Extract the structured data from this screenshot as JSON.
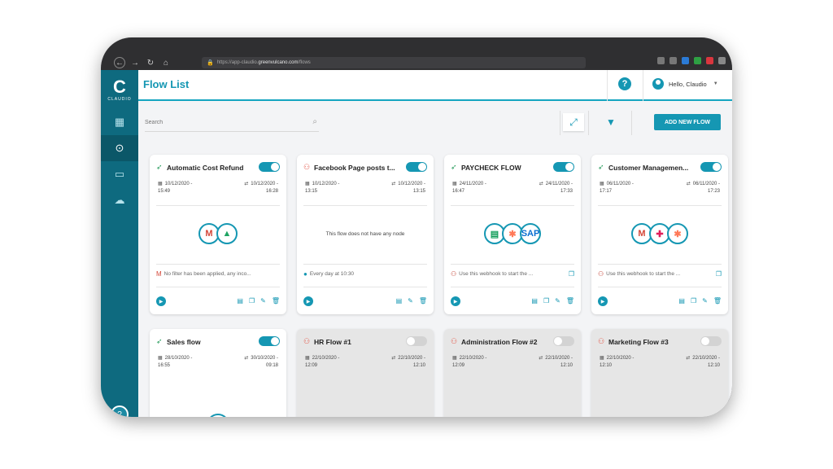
{
  "browser": {
    "url_prefix": "https://app-claudio.",
    "url_host": "greenvulcano.com",
    "url_path": "/flows"
  },
  "sidebar": {
    "logo_mark": "C",
    "logo_name": "CLAUDIO",
    "items": [
      {
        "icon": "dashboard-icon",
        "glyph": "▦"
      },
      {
        "icon": "flow-icon",
        "glyph": "⊙"
      },
      {
        "icon": "terminal-icon",
        "glyph": "▭"
      },
      {
        "icon": "cloud-icon",
        "glyph": "☁"
      }
    ],
    "bottom_glyph": "?"
  },
  "header": {
    "title": "Flow List",
    "help_glyph": "?",
    "user_greeting": "Hello, Claudio"
  },
  "toolbar": {
    "search_placeholder": "Search",
    "add_label": "ADD NEW FLOW"
  },
  "flows": [
    {
      "title": "Automatic Cost Refund",
      "icon": "rocket",
      "active": true,
      "created": "10/12/2020 -",
      "created_time": "15:49",
      "updated": "10/12/2020 -",
      "updated_time": "16:28",
      "nodes": [
        {
          "glyph": "M",
          "color": "#d44638"
        },
        {
          "glyph": "▲",
          "color": "#1fa463"
        }
      ],
      "empty_text": "",
      "trigger": "No filter has been applied, any inco...",
      "trigger_icon": "gmail",
      "has_copy": false
    },
    {
      "title": "Facebook Page posts t...",
      "icon": "webhook",
      "active": true,
      "created": "10/12/2020 -",
      "created_time": "13:15",
      "updated": "10/12/2020 -",
      "updated_time": "13:15",
      "nodes": [],
      "empty_text": "This flow does not have any node",
      "trigger": "Every day at 10:30",
      "trigger_icon": "clock",
      "has_copy": false
    },
    {
      "title": "PAYCHECK FLOW",
      "icon": "rocket",
      "active": true,
      "created": "24/11/2020 -",
      "created_time": "16:47",
      "updated": "24/11/2020 -",
      "updated_time": "17:33",
      "nodes": [
        {
          "glyph": "▤",
          "color": "#0f9d58"
        },
        {
          "glyph": "✱",
          "color": "#ff7a59"
        },
        {
          "glyph": "SAP",
          "color": "#0a6ed1"
        }
      ],
      "empty_text": "",
      "trigger": "Use this webhook to start the ...",
      "trigger_icon": "webhook",
      "has_copy": true
    },
    {
      "title": "Customer Managemen...",
      "icon": "rocket",
      "active": true,
      "created": "06/11/2020 -",
      "created_time": "17:17",
      "updated": "06/11/2020 -",
      "updated_time": "17:23",
      "nodes": [
        {
          "glyph": "M",
          "color": "#d44638"
        },
        {
          "glyph": "✚",
          "color": "#e01e5a"
        },
        {
          "glyph": "✱",
          "color": "#ff7a59"
        }
      ],
      "empty_text": "",
      "trigger": "Use this webhook to start the ...",
      "trigger_icon": "webhook",
      "has_copy": true
    },
    {
      "title": "Sales flow",
      "icon": "rocket",
      "active": true,
      "created": "28/10/2020 -",
      "created_time": "16:55",
      "updated": "30/10/2020 -",
      "updated_time": "09:18",
      "nodes": [],
      "empty_text": "",
      "trigger": "",
      "partial": true
    },
    {
      "title": "HR Flow #1",
      "icon": "webhook",
      "active": false,
      "created": "22/10/2020 -",
      "created_time": "12:09",
      "updated": "22/10/2020 -",
      "updated_time": "12:10",
      "nodes": [],
      "empty_text": "",
      "trigger": "",
      "partial": true
    },
    {
      "title": "Administration Flow #2",
      "icon": "webhook",
      "active": false,
      "created": "22/10/2020 -",
      "created_time": "12:09",
      "updated": "22/10/2020 -",
      "updated_time": "12:10",
      "nodes": [],
      "empty_text": "",
      "trigger": "",
      "partial": true
    },
    {
      "title": "Marketing Flow #3",
      "icon": "webhook",
      "active": false,
      "created": "22/10/2020 -",
      "created_time": "12:10",
      "updated": "22/10/2020 -",
      "updated_time": "12:10",
      "nodes": [],
      "empty_text": "",
      "trigger": "",
      "partial": true
    }
  ],
  "colors": {
    "accent": "#1597b3",
    "sidebar": "#0e6a7f",
    "toggle_off": "#d3d3d3"
  }
}
